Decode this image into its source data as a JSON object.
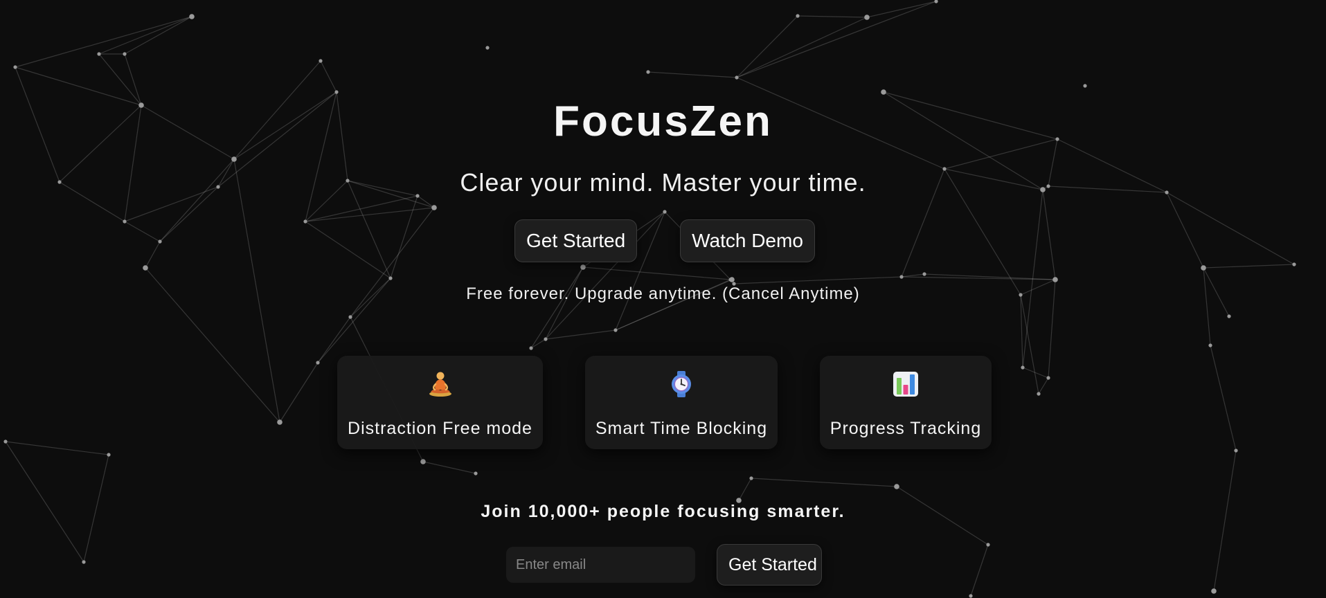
{
  "hero": {
    "title": "FocusZen",
    "subtitle": "Clear your mind. Master your time.",
    "primary_button": "Get Started",
    "secondary_button": "Watch Demo",
    "pricing_note": "Free forever. Upgrade anytime. (Cancel Anytime)"
  },
  "features": [
    {
      "label": "Distraction Free mode",
      "icon": "meditation-icon"
    },
    {
      "label": "Smart Time Blocking",
      "icon": "watch-icon"
    },
    {
      "label": "Progress Tracking",
      "icon": "bar-chart-icon"
    }
  ],
  "signup": {
    "heading": "Join 10,000+ people focusing smarter.",
    "email_placeholder": "Enter email",
    "email_value": "",
    "button": "Get Started"
  },
  "colors": {
    "background": "#0d0d0d",
    "text": "#f5f5f5",
    "button_bg": "#1e1e1e",
    "card_bg": "#1a1a1a"
  }
}
